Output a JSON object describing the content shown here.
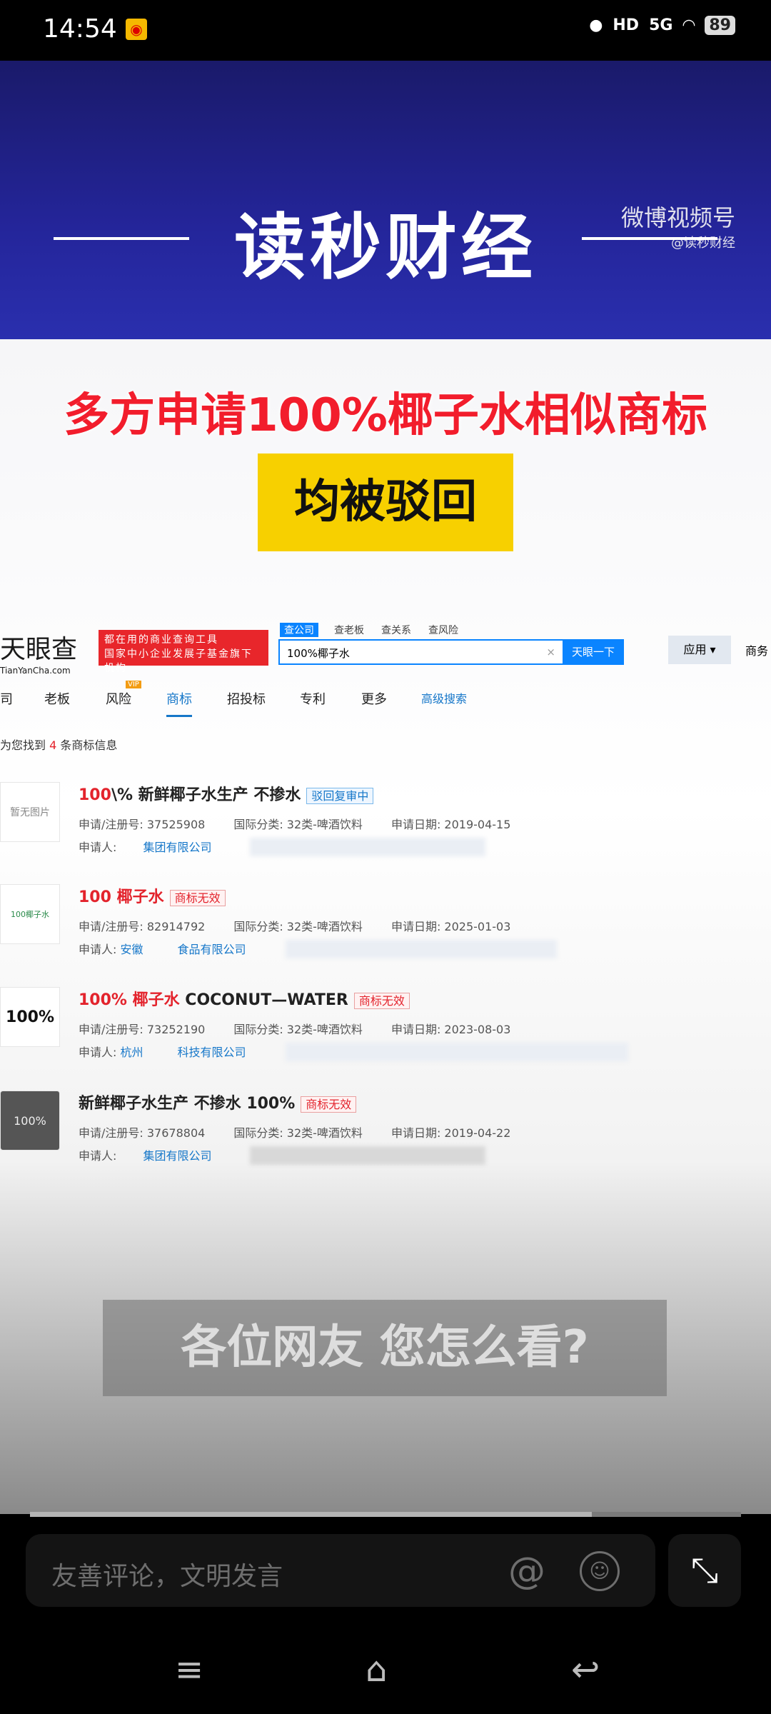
{
  "status": {
    "time": "14:54",
    "battery": "89",
    "network": "5G",
    "hd": "HD"
  },
  "banner": {
    "brand": "读秒财经",
    "watermark": "微博视频号",
    "handle": "@读秒财经"
  },
  "headline": "多方申请100%椰子水相似商标",
  "highlight": "均被驳回",
  "tianyancha": {
    "logo": "天眼查",
    "logo_sub": "TianYanCha.com",
    "ad_line1": "都在用的商业查询工具",
    "ad_line2": "国家中小企业发展子基金旗下机构",
    "search_tabs": [
      "查公司",
      "查老板",
      "查关系",
      "查风险"
    ],
    "search_value": "100%椰子水",
    "clear": "×",
    "search_button": "天眼一下",
    "apps": "应用 ▾",
    "biz": "商务",
    "nav": [
      "司",
      "老板",
      "风险",
      "商标",
      "招投标",
      "专利",
      "更多",
      "高级搜索"
    ],
    "vip": "VIP",
    "found_prefix": "为您找到",
    "found_count": "4",
    "found_suffix": "条商标信息",
    "results": [
      {
        "thumb": "暂无图片",
        "title_red": "100",
        "title_rest": "\\% 新鲜椰子水生产 不掺水",
        "status": "驳回复审中",
        "reg_no": "申请/注册号: 37525908",
        "cls": "国际分类: 32类-啤酒饮料",
        "date": "申请日期: 2019-04-15",
        "applicant_label": "申请人:",
        "applicant": "集团有限公司"
      },
      {
        "thumb": "100椰子水",
        "title_red": "100 椰子水",
        "title_rest": "",
        "status": "商标无效",
        "reg_no": "申请/注册号: 82914792",
        "cls": "国际分类: 32类-啤酒饮料",
        "date": "申请日期: 2025-01-03",
        "applicant_label": "申请人:",
        "applicant": "安徽　　　食品有限公司"
      },
      {
        "thumb": "100%",
        "title_red": "100% 椰子水",
        "title_rest": " COCONUT—WATER",
        "status": "商标无效",
        "reg_no": "申请/注册号: 73252190",
        "cls": "国际分类: 32类-啤酒饮料",
        "date": "申请日期: 2023-08-03",
        "applicant_label": "申请人:",
        "applicant": "杭州　　　科技有限公司"
      },
      {
        "thumb": "100%",
        "title_red": "",
        "title_rest": "新鲜椰子水生产 不掺水 100%",
        "status": "商标无效",
        "reg_no": "申请/注册号: 37678804",
        "cls": "国际分类: 32类-啤酒饮料",
        "date": "申请日期: 2019-04-22",
        "applicant_label": "申请人:",
        "applicant": "集团有限公司"
      }
    ]
  },
  "subtitle": "各位网友 您怎么看?",
  "video_progress": 0.79,
  "comment": {
    "placeholder": "友善评论，文明发言",
    "at": "@",
    "emoji": "☺",
    "fullscreen": "⤡"
  },
  "navbar": {
    "menu": "≡",
    "home": "⌂",
    "back": "↩"
  }
}
